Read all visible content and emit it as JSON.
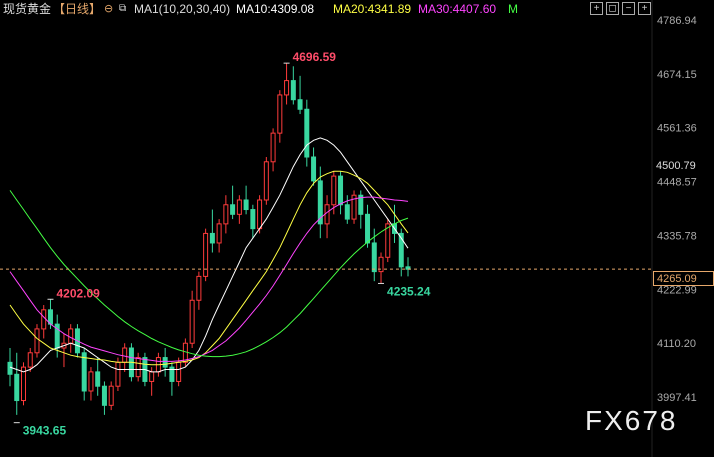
{
  "header": {
    "title": "现货黄金",
    "period": "【日线】",
    "indicator": "MA1(10,20,30,40)",
    "ma10": "MA10:4309.08",
    "ma20": "MA20:4341.89",
    "ma30": "MA30:4407.60",
    "more": "M"
  },
  "current_price": "4265.09",
  "ref_price": "4500.79",
  "watermark": "FX678",
  "colors": {
    "up": "#ff3b3b",
    "down": "#39d7a0",
    "ma10": "#ffffff",
    "ma20": "#ffff44",
    "ma30": "#ff44ff",
    "ma40": "#44ff44",
    "price_line": "#e6a86b"
  },
  "chart_data": {
    "type": "candlestick",
    "y_ticks": [
      "4786.94",
      "4674.15",
      "4561.36",
      "4448.57",
      "4335.78",
      "4222.99",
      "4110.20",
      "3997.41"
    ],
    "annotations": {
      "high": "4696.59",
      "low": "3943.65",
      "mid_high": "4202.09",
      "recent_low": "4235.24"
    },
    "candles": [
      [
        4070,
        4100,
        4020,
        4045
      ],
      [
        4045,
        4090,
        3960,
        3990
      ],
      [
        3990,
        4070,
        3980,
        4060
      ],
      [
        4060,
        4100,
        4050,
        4090
      ],
      [
        4090,
        4150,
        4080,
        4140
      ],
      [
        4140,
        4190,
        4120,
        4180
      ],
      [
        4180,
        4202,
        4140,
        4150
      ],
      [
        4150,
        4170,
        4080,
        4100
      ],
      [
        4100,
        4130,
        4060,
        4110
      ],
      [
        4110,
        4150,
        4090,
        4140
      ],
      [
        4140,
        4150,
        4080,
        4090
      ],
      [
        4090,
        4100,
        3990,
        4010
      ],
      [
        4010,
        4060,
        3990,
        4050
      ],
      [
        4050,
        4080,
        4000,
        4020
      ],
      [
        4020,
        4030,
        3960,
        3980
      ],
      [
        3980,
        4030,
        3970,
        4020
      ],
      [
        4020,
        4080,
        4010,
        4070
      ],
      [
        4070,
        4110,
        4050,
        4100
      ],
      [
        4100,
        4110,
        4030,
        4040
      ],
      [
        4040,
        4090,
        4030,
        4080
      ],
      [
        4080,
        4090,
        4020,
        4030
      ],
      [
        4030,
        4060,
        4000,
        4050
      ],
      [
        4050,
        4090,
        4040,
        4080
      ],
      [
        4080,
        4100,
        4040,
        4060
      ],
      [
        4060,
        4070,
        4000,
        4030
      ],
      [
        4030,
        4080,
        4020,
        4070
      ],
      [
        4070,
        4120,
        4060,
        4110
      ],
      [
        4110,
        4220,
        4100,
        4200
      ],
      [
        4200,
        4260,
        4180,
        4250
      ],
      [
        4250,
        4350,
        4240,
        4340
      ],
      [
        4340,
        4390,
        4300,
        4320
      ],
      [
        4320,
        4370,
        4300,
        4360
      ],
      [
        4360,
        4420,
        4340,
        4400
      ],
      [
        4400,
        4440,
        4370,
        4380
      ],
      [
        4380,
        4420,
        4360,
        4410
      ],
      [
        4410,
        4440,
        4380,
        4390
      ],
      [
        4390,
        4400,
        4330,
        4350
      ],
      [
        4350,
        4420,
        4340,
        4410
      ],
      [
        4410,
        4500,
        4400,
        4490
      ],
      [
        4490,
        4560,
        4470,
        4550
      ],
      [
        4550,
        4640,
        4530,
        4630
      ],
      [
        4630,
        4696,
        4610,
        4660
      ],
      [
        4660,
        4690,
        4610,
        4620
      ],
      [
        4620,
        4670,
        4590,
        4600
      ],
      [
        4600,
        4620,
        4480,
        4500
      ],
      [
        4500,
        4520,
        4440,
        4450
      ],
      [
        4450,
        4480,
        4330,
        4360
      ],
      [
        4360,
        4420,
        4330,
        4400
      ],
      [
        4400,
        4470,
        4380,
        4460
      ],
      [
        4460,
        4470,
        4380,
        4400
      ],
      [
        4400,
        4420,
        4360,
        4370
      ],
      [
        4370,
        4430,
        4360,
        4420
      ],
      [
        4420,
        4430,
        4350,
        4380
      ],
      [
        4380,
        4400,
        4310,
        4320
      ],
      [
        4320,
        4350,
        4240,
        4260
      ],
      [
        4260,
        4300,
        4235,
        4290
      ],
      [
        4290,
        4370,
        4280,
        4360
      ],
      [
        4360,
        4400,
        4320,
        4340
      ],
      [
        4340,
        4350,
        4250,
        4270
      ],
      [
        4270,
        4290,
        4250,
        4265
      ]
    ],
    "ma10": [
      4060,
      4055,
      4050,
      4055,
      4065,
      4080,
      4095,
      4100,
      4105,
      4110,
      4105,
      4100,
      4090,
      4080,
      4070,
      4060,
      4055,
      4055,
      4055,
      4055,
      4055,
      4050,
      4050,
      4055,
      4055,
      4055,
      4060,
      4075,
      4095,
      4125,
      4160,
      4190,
      4220,
      4250,
      4280,
      4310,
      4330,
      4350,
      4370,
      4395,
      4420,
      4450,
      4480,
      4505,
      4525,
      4535,
      4540,
      4535,
      4525,
      4510,
      4490,
      4470,
      4450,
      4430,
      4410,
      4390,
      4370,
      4350,
      4330,
      4309
    ],
    "ma20": [
      4190,
      4170,
      4150,
      4135,
      4120,
      4110,
      4100,
      4095,
      4090,
      4085,
      4082,
      4080,
      4078,
      4076,
      4075,
      4072,
      4070,
      4070,
      4070,
      4068,
      4066,
      4065,
      4065,
      4066,
      4068,
      4070,
      4072,
      4075,
      4080,
      4090,
      4105,
      4120,
      4140,
      4160,
      4180,
      4200,
      4220,
      4240,
      4260,
      4285,
      4310,
      4340,
      4370,
      4400,
      4425,
      4445,
      4458,
      4465,
      4470,
      4470,
      4468,
      4462,
      4455,
      4445,
      4430,
      4415,
      4400,
      4380,
      4360,
      4341
    ],
    "ma30": [
      4260,
      4240,
      4220,
      4200,
      4180,
      4165,
      4150,
      4140,
      4130,
      4122,
      4115,
      4108,
      4102,
      4098,
      4094,
      4090,
      4086,
      4083,
      4080,
      4078,
      4076,
      4074,
      4072,
      4072,
      4072,
      4073,
      4075,
      4078,
      4082,
      4088,
      4095,
      4105,
      4115,
      4128,
      4142,
      4158,
      4175,
      4192,
      4210,
      4230,
      4252,
      4275,
      4298,
      4320,
      4340,
      4358,
      4372,
      4384,
      4394,
      4402,
      4408,
      4412,
      4415,
      4416,
      4416,
      4414,
      4412,
      4410,
      4409,
      4407
    ],
    "ma40": [
      4430,
      4410,
      4390,
      4370,
      4350,
      4330,
      4310,
      4292,
      4275,
      4260,
      4245,
      4230,
      4216,
      4203,
      4190,
      4178,
      4166,
      4155,
      4145,
      4136,
      4128,
      4120,
      4113,
      4107,
      4101,
      4096,
      4092,
      4088,
      4085,
      4083,
      4082,
      4082,
      4083,
      4085,
      4088,
      4092,
      4098,
      4105,
      4113,
      4122,
      4132,
      4144,
      4158,
      4172,
      4188,
      4204,
      4220,
      4236,
      4252,
      4268,
      4283,
      4297,
      4310,
      4322,
      4333,
      4343,
      4352,
      4360,
      4367,
      4372
    ]
  }
}
